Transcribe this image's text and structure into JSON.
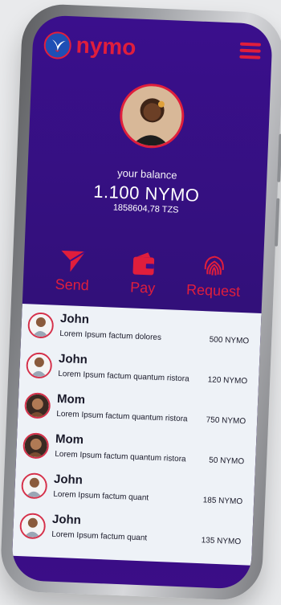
{
  "app": {
    "name": "nymo",
    "logo_icon": "nymo-bird-icon",
    "menu_icon": "hamburger-menu-icon"
  },
  "balance": {
    "label": "your balance",
    "amount": "1.100 NYMO",
    "converted": "1858604,78 TZS"
  },
  "actions": [
    {
      "label": "Send",
      "icon": "send-arrow-icon"
    },
    {
      "label": "Pay",
      "icon": "wallet-icon"
    },
    {
      "label": "Request",
      "icon": "fingerprint-icon"
    }
  ],
  "transactions": [
    {
      "name": "John",
      "description": "Lorem Ipsum factum  dolores",
      "amount": "500 NYMO"
    },
    {
      "name": "John",
      "description": "Lorem Ipsum factum quantum ristora",
      "amount": "120 NYMO"
    },
    {
      "name": "Mom",
      "description": "Lorem Ipsum factum quantum ristora",
      "amount": "750 NYMO"
    },
    {
      "name": "Mom",
      "description": "Lorem Ipsum factum quantum ristora",
      "amount": "50 NYMO"
    },
    {
      "name": "John",
      "description": "Lorem Ipsum factum quant",
      "amount": "185  NYMO"
    },
    {
      "name": "John",
      "description": "Lorem Ipsum factum quant",
      "amount": "135  NYMO"
    }
  ],
  "colors": {
    "brand_red": "#e01e3c",
    "brand_purple": "#3a0f8c",
    "list_bg": "#eef2f7"
  }
}
